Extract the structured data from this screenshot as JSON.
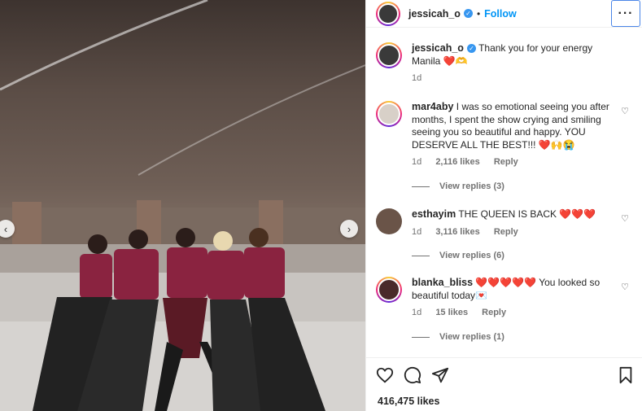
{
  "header": {
    "username": "jessicah_o",
    "follow_label": "Follow",
    "more_label": "···"
  },
  "media": {
    "prev_arrow": "‹",
    "next_arrow": "›"
  },
  "comments": [
    {
      "username": "jessicah_o",
      "text": "Thank you for your energy Manila ❤️🫶",
      "time": "1d",
      "verified": true
    },
    {
      "username": "mar4aby",
      "text": "I was so emotional seeing you after months, I spent the show crying and smiling seeing you so beautiful and happy. YOU DESERVE ALL THE BEST!!! ❤️🙌😭",
      "time": "1d",
      "likes": "2,116 likes",
      "reply": "Reply",
      "view_replies": "View replies (3)"
    },
    {
      "username": "esthayim",
      "text": "THE QUEEN IS BACK ❤️❤️❤️",
      "time": "1d",
      "likes": "3,116 likes",
      "reply": "Reply",
      "view_replies": "View replies (6)"
    },
    {
      "username": "blanka_bliss",
      "text": "❤️❤️❤️❤️❤️ You looked so beautiful today💌",
      "time": "1d",
      "likes": "15 likes",
      "reply": "Reply",
      "view_replies": "View replies (1)"
    }
  ],
  "footer": {
    "likes": "416,475 likes"
  },
  "icons": {
    "like": "heart-icon",
    "comment": "comment-bubble-icon",
    "share": "paper-plane-icon",
    "save": "bookmark-icon"
  },
  "colors": {
    "accent": "#0095f6",
    "heart": "#ed4956",
    "verified": "#3897f0"
  }
}
